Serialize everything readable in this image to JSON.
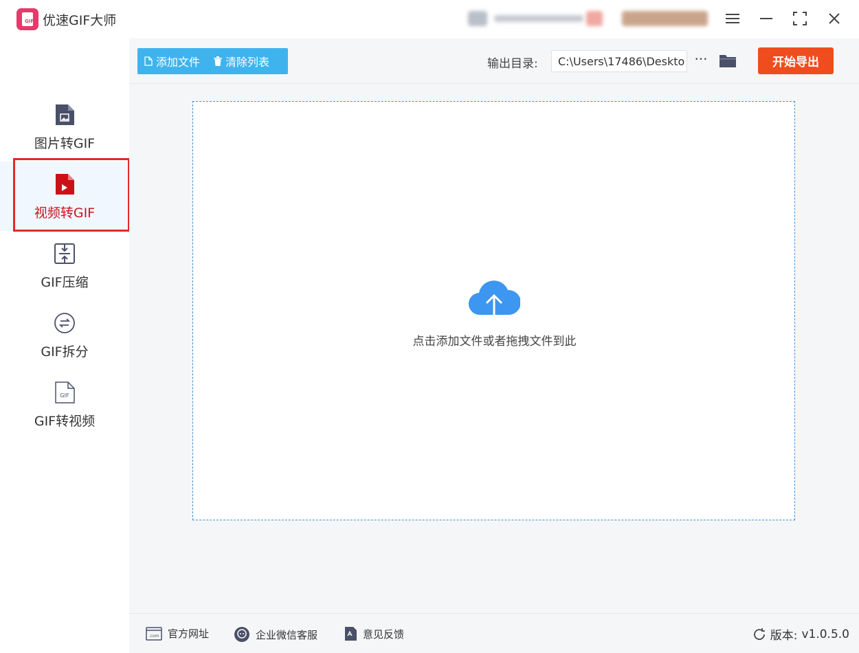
{
  "window": {
    "title": "优速GIF大师",
    "logo_text": "GIF",
    "controls": [
      "menu",
      "minimize",
      "maximize",
      "close"
    ]
  },
  "sidebar": {
    "items": [
      {
        "label": "图片转GIF",
        "icon": "image-file-icon",
        "active": false
      },
      {
        "label": "视频转GIF",
        "icon": "video-file-icon",
        "active": true
      },
      {
        "label": "GIF压缩",
        "icon": "compress-icon",
        "active": false
      },
      {
        "label": "GIF拆分",
        "icon": "split-icon",
        "active": false
      },
      {
        "label": "GIF转视频",
        "icon": "gif-file-icon",
        "active": false
      }
    ]
  },
  "toolbar": {
    "add_file_label": "添加文件",
    "clear_list_label": "清除列表",
    "output_dir_label": "输出目录:",
    "output_dir_value": "C:\\Users\\17486\\Deskto",
    "more_label": "···",
    "export_label": "开始导出"
  },
  "dropzone": {
    "text": "点击添加文件或者拖拽文件到此"
  },
  "footer": {
    "website_label": "官方网址",
    "wechat_label": "企业微信客服",
    "feedback_label": "意见反馈",
    "version_label": "版本:",
    "version_value": "v1.0.5.0"
  },
  "colors": {
    "accent_blue": "#3fb3ee",
    "export_red": "#f04d1e",
    "active_red": "#c8141c",
    "annotation_red": "#e5282a",
    "icon_gray": "#4a5068"
  }
}
